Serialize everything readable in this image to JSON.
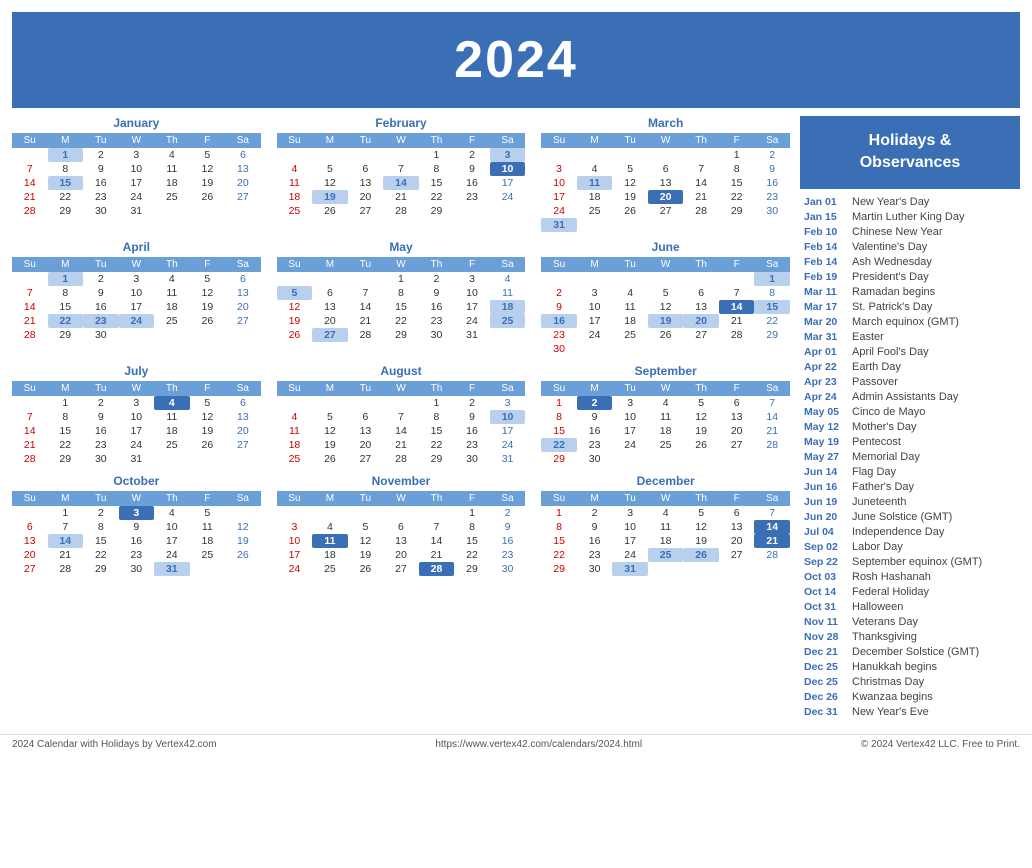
{
  "header": {
    "year": "2024"
  },
  "footer": {
    "left": "2024 Calendar with Holidays by Vertex42.com",
    "center": "https://www.vertex42.com/calendars/2024.html",
    "right": "© 2024 Vertex42 LLC. Free to Print."
  },
  "sidebar": {
    "title": "Holidays &\nObservances",
    "holidays": [
      {
        "date": "Jan 01",
        "name": "New Year's Day"
      },
      {
        "date": "Jan 15",
        "name": "Martin Luther King Day"
      },
      {
        "date": "Feb 10",
        "name": "Chinese New Year"
      },
      {
        "date": "Feb 14",
        "name": "Valentine's Day"
      },
      {
        "date": "Feb 14",
        "name": "Ash Wednesday"
      },
      {
        "date": "Feb 19",
        "name": "President's Day"
      },
      {
        "date": "Mar 11",
        "name": "Ramadan begins"
      },
      {
        "date": "Mar 17",
        "name": "St. Patrick's Day"
      },
      {
        "date": "Mar 20",
        "name": "March equinox (GMT)"
      },
      {
        "date": "Mar 31",
        "name": "Easter"
      },
      {
        "date": "Apr 01",
        "name": "April Fool's Day"
      },
      {
        "date": "Apr 22",
        "name": "Earth Day"
      },
      {
        "date": "Apr 23",
        "name": "Passover"
      },
      {
        "date": "Apr 24",
        "name": "Admin Assistants Day"
      },
      {
        "date": "May 05",
        "name": "Cinco de Mayo"
      },
      {
        "date": "May 12",
        "name": "Mother's Day"
      },
      {
        "date": "May 19",
        "name": "Pentecost"
      },
      {
        "date": "May 27",
        "name": "Memorial Day"
      },
      {
        "date": "Jun 14",
        "name": "Flag Day"
      },
      {
        "date": "Jun 16",
        "name": "Father's Day"
      },
      {
        "date": "Jun 19",
        "name": "Juneteenth"
      },
      {
        "date": "Jun 20",
        "name": "June Solstice (GMT)"
      },
      {
        "date": "Jul 04",
        "name": "Independence Day"
      },
      {
        "date": "Sep 02",
        "name": "Labor Day"
      },
      {
        "date": "Sep 22",
        "name": "September equinox (GMT)"
      },
      {
        "date": "Oct 03",
        "name": "Rosh Hashanah"
      },
      {
        "date": "Oct 14",
        "name": "Federal Holiday"
      },
      {
        "date": "Oct 31",
        "name": "Halloween"
      },
      {
        "date": "Nov 11",
        "name": "Veterans Day"
      },
      {
        "date": "Nov 28",
        "name": "Thanksgiving"
      },
      {
        "date": "Dec 21",
        "name": "December Solstice (GMT)"
      },
      {
        "date": "Dec 25",
        "name": "Hanukkah begins"
      },
      {
        "date": "Dec 25",
        "name": "Christmas Day"
      },
      {
        "date": "Dec 26",
        "name": "Kwanzaa begins"
      },
      {
        "date": "Dec 31",
        "name": "New Year's Eve"
      }
    ]
  }
}
